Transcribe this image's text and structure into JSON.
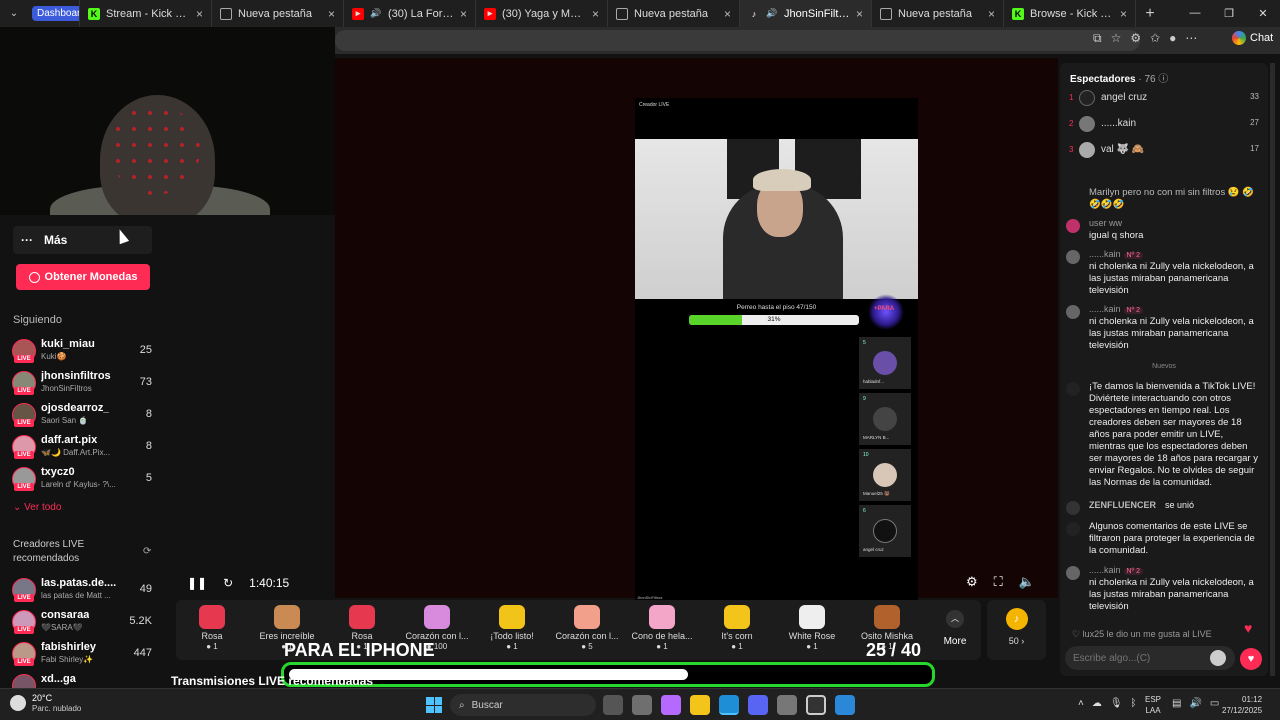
{
  "tabs": [
    {
      "label": "Dashboard",
      "kind": "badge"
    },
    {
      "label": "Stream - Kick Dashboard",
      "favicon": "kick-icon",
      "color": "#53fc18"
    },
    {
      "label": "Nueva pestaña",
      "favicon": "page-icon",
      "color": "#888888"
    },
    {
      "label": "(30) La Forma En Que",
      "favicon": "youtube-icon",
      "color": "#ff0000"
    },
    {
      "label": "(30) Yaga y Mackie feat. Ar",
      "favicon": "youtube-icon",
      "color": "#ff0000"
    },
    {
      "label": "Nueva pestaña",
      "favicon": "page-icon",
      "color": "#888888"
    },
    {
      "label": "JhonSinFiltros (@jhon",
      "favicon": "tiktok-icon",
      "color": "#ffffff",
      "active": true
    },
    {
      "label": "Nueva pestaña",
      "favicon": "page-icon",
      "color": "#888888"
    },
    {
      "label": "Browse - Kick Streaming",
      "favicon": "kick-icon",
      "color": "#53fc18"
    }
  ],
  "browser": {
    "chat_label": "Chat"
  },
  "sidebar": {
    "more_label": "Más",
    "coins_button": "Obtener Monedas",
    "following_heading": "Siguiendo",
    "following": [
      {
        "name": "kuki_miau",
        "sub": "Kuki🍪",
        "count": "25"
      },
      {
        "name": "jhonsinfiltros",
        "sub": "JhonSinFiltros",
        "count": "73"
      },
      {
        "name": "ojosdearroz_",
        "sub": "Saori San 🍵",
        "count": "8"
      },
      {
        "name": "daff.art.pix",
        "sub": "🦋🌙 Daff.Art.Pix...",
        "count": "8"
      },
      {
        "name": "txycz0",
        "sub": "Lareln d' Kaylus- ?\\...",
        "count": "5"
      }
    ],
    "see_all": "Ver todo",
    "recommended_heading": "Creadores LIVE recomendados",
    "recommended": [
      {
        "name": "las.patas.de....",
        "sub": "las patas de Matt ...",
        "count": "49"
      },
      {
        "name": "consaraa",
        "sub": "🖤SARA🖤",
        "count": "5.2K"
      },
      {
        "name": "fabishirley",
        "sub": "Fabi Shirley✨",
        "count": "447"
      },
      {
        "name": "xd...ga",
        "sub": "",
        "count": ""
      }
    ],
    "live_tag": "LIVE"
  },
  "stream": {
    "label": "Creador LIVE",
    "goal_label": "Perreo hasta el piso  47/150",
    "goal_fraction": 0.31,
    "goal_pct_text": "31%",
    "gift_badge": "+PARA",
    "footer": "JhonSinFiltros",
    "guests": [
      {
        "count": "5",
        "name": "habladnf..."
      },
      {
        "count": "9",
        "name": "MARLYN B..."
      },
      {
        "count": "10",
        "name": "Manuel25 🐻"
      },
      {
        "count": "6",
        "name": "angel cruz"
      }
    ],
    "time": "1:40:15"
  },
  "gifts": [
    {
      "name": "Rosa",
      "price": "1",
      "color": "#e63950"
    },
    {
      "name": "Eres increíble",
      "price": "1",
      "color": "#c98a54"
    },
    {
      "name": "Rosa",
      "price": "1",
      "color": "#e63950"
    },
    {
      "name": "Corazón con l...",
      "price": "100",
      "color": "#d88bdc"
    },
    {
      "name": "¡Todo listo!",
      "price": "1",
      "color": "#f2c319"
    },
    {
      "name": "Corazón con l...",
      "price": "5",
      "color": "#f2a08c"
    },
    {
      "name": "Cono de hela...",
      "price": "1",
      "color": "#f3a6c8"
    },
    {
      "name": "It's corn",
      "price": "1",
      "color": "#f3c419"
    },
    {
      "name": "White Rose",
      "price": "1",
      "color": "#eeeeee"
    },
    {
      "name": "Osito Mishka",
      "price": "1",
      "color": "#b0612c"
    }
  ],
  "gift_more_label": "More",
  "coin_balance": "50",
  "overlay": {
    "text": "PARA EL IPHONE",
    "count": "25 / 40",
    "progress_fraction": 0.625
  },
  "recommended_title": "Transmisiones LIVE recomendadas",
  "chat": {
    "viewers_label": "Espectadores",
    "viewers_count": "· 76",
    "top_viewers": [
      {
        "rank": "1",
        "name": "angel cruz",
        "score": "33"
      },
      {
        "rank": "2",
        "name": "......kain",
        "score": "27"
      },
      {
        "rank": "3",
        "name": "val 🐺 🙈",
        "score": "17"
      }
    ],
    "messages": [
      {
        "user": "",
        "level": "",
        "text": "Marilyn pero no con mi sin filtros 😢 🤣🤣🤣🤣"
      },
      {
        "user": "user ww",
        "level": "",
        "text": "igual q shora"
      },
      {
        "user": "......kain",
        "level": "Nº 2",
        "text": "ni cholenka ni Zully vela nickelodeon, a las justas miraban panamericana televisión"
      },
      {
        "user": "......kain",
        "level": "Nº 2",
        "text": "ni cholenka ni Zully vela nickelodeon, a las justas miraban panamericana televisión"
      }
    ],
    "new_label": "Nuevos",
    "welcome": "¡Te damos la bienvenida a TikTok LIVE! Diviértete interactuando con otros espectadores en tiempo real. Los creadores deben ser mayores de 18 años para poder emitir un LIVE, mientras que los espectadores deben ser mayores de 18 años para recargar y enviar Regalos. No te olvides de seguir las Normas de la comunidad.",
    "join_user": "ZENFLUENCER",
    "join_text": "se unió",
    "filter_note": "Algunos comentarios de este LIVE se filtraron para proteger la experiencia de la comunidad.",
    "last_user": "......kain",
    "last_level": "Nº 2",
    "last_text": "ni cholenka ni Zully vela nickelodeon, a las justas miraban panamericana televisión",
    "like_text": "lux25 le dio un me gusta al LIVE",
    "input_placeholder": "Escribe algo...(C)"
  },
  "taskbar": {
    "temp": "20°C",
    "weather": "Parc. nublado",
    "search": "Buscar",
    "lang1": "ESP",
    "lang2": "LAA",
    "time": "01:12",
    "date": "27/12/2025"
  }
}
